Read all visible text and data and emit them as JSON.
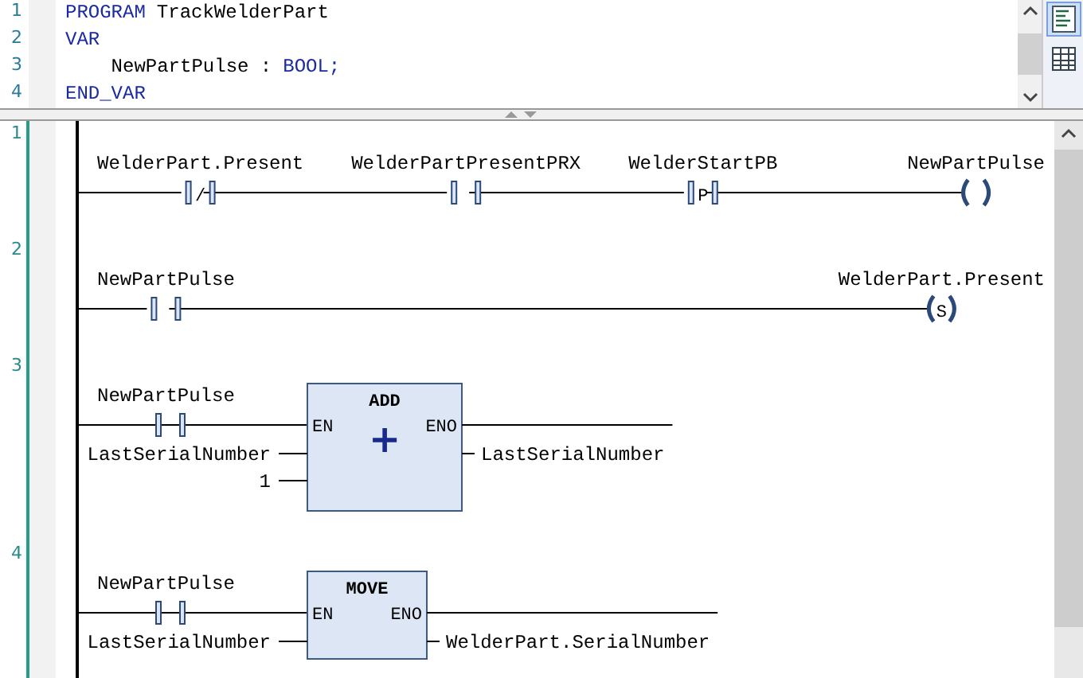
{
  "declaration": {
    "lines": [
      {
        "number": "1",
        "tokens": [
          {
            "kind": "keyword",
            "text": "PROGRAM"
          },
          {
            "kind": "plain",
            "text": "TrackWelderPart"
          }
        ]
      },
      {
        "number": "2",
        "tokens": [
          {
            "kind": "keyword",
            "text": "VAR"
          }
        ]
      },
      {
        "number": "3",
        "tokens": [
          {
            "kind": "plain",
            "text": "    NewPartPulse :"
          },
          {
            "kind": "keyword",
            "text": "BOOL;"
          }
        ]
      },
      {
        "number": "4",
        "tokens": [
          {
            "kind": "keyword",
            "text": "END_VAR"
          }
        ]
      }
    ]
  },
  "view_buttons": [
    {
      "kind": "text",
      "selected": true
    },
    {
      "kind": "table",
      "selected": false
    }
  ],
  "networks": [
    {
      "number": "1",
      "kind": "rung",
      "contacts": [
        {
          "variable": "WelderPart.Present",
          "symbol": "/"
        },
        {
          "variable": "WelderPartPresentPRX"
        },
        {
          "variable": "WelderStartPB",
          "symbol": "P"
        }
      ],
      "coil": {
        "variable": "NewPartPulse"
      }
    },
    {
      "number": "2",
      "kind": "rung",
      "contacts": [
        {
          "variable": "NewPartPulse"
        }
      ],
      "coil": {
        "variable": "WelderPart.Present",
        "symbol": "S"
      }
    },
    {
      "number": "3",
      "kind": "block",
      "contact": "NewPartPulse",
      "block": {
        "name": "ADD",
        "operator": "+",
        "en": "EN",
        "eno": "ENO",
        "inputs": [
          "LastSerialNumber",
          "1"
        ],
        "outputs": [
          "LastSerialNumber"
        ]
      }
    },
    {
      "number": "4",
      "kind": "block",
      "contact": "NewPartPulse",
      "block": {
        "name": "MOVE",
        "en": "EN",
        "eno": "ENO",
        "inputs": [
          "LastSerialNumber"
        ],
        "outputs": [
          "WelderPart.SerialNumber"
        ]
      }
    }
  ]
}
